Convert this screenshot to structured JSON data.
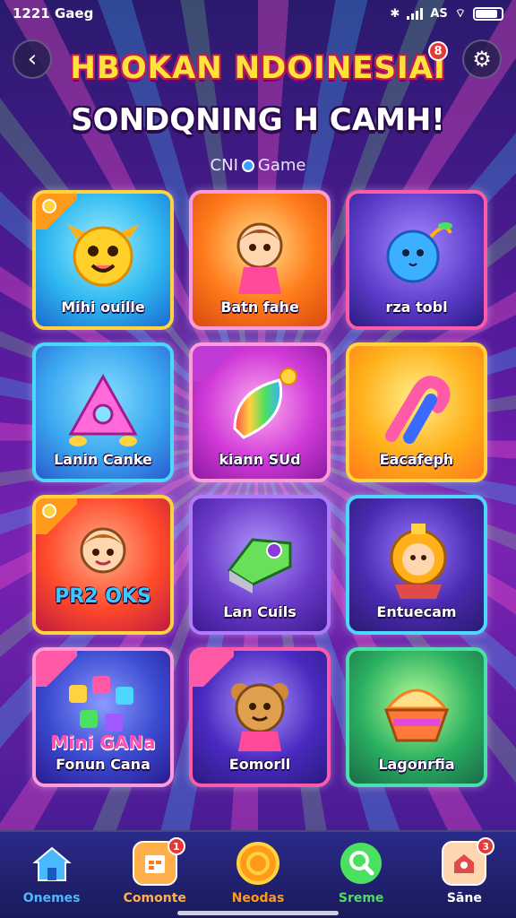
{
  "status_bar": {
    "time": "1221 Gaeg",
    "network": "AS"
  },
  "header": {
    "title_line1": "HBOKAN NDOINESIAI",
    "title_line2": "SONDQNING H CAMH!",
    "subtitle_prefix": "CNI",
    "subtitle_suffix": "Game",
    "title_badge": "8"
  },
  "tiles": [
    {
      "label": "Mihi ouille",
      "icon": "cute-monster-icon",
      "bg": "#2fb8f0"
    },
    {
      "label": "Batn fahe",
      "icon": "girl-character-icon",
      "bg": "#ff7a1a"
    },
    {
      "label": "rza tobl",
      "icon": "blue-ball-icon",
      "bg": "#5a3ac8"
    },
    {
      "label": "Lanin Canke",
      "icon": "donut-candy-icon",
      "bg": "#3aa8f0"
    },
    {
      "label": "kiann SUd",
      "icon": "rainbow-gem-icon",
      "bg": "#d03ad8"
    },
    {
      "label": "Eacafeph",
      "icon": "candy-cane-icon",
      "bg": "#ffb01a"
    },
    {
      "label": "PR2 OKS",
      "icon": "girl-character-icon",
      "bg": "#ff4a2a"
    },
    {
      "label": "Lan Cuils",
      "icon": "green-gem-icon",
      "bg": "#6a3ac8"
    },
    {
      "label": "Entuecam",
      "icon": "monkey-character-icon",
      "bg": "#4a2ab0"
    },
    {
      "label": "Fonun Cana",
      "big_label": "Mini GANa",
      "icon": "candy-blocks-icon",
      "bg": "#3a4ad0"
    },
    {
      "label": "Eomorll",
      "icon": "bear-character-icon",
      "bg": "#4a2ac0"
    },
    {
      "label": "Lagonrfia",
      "icon": "ice-cream-bowl-icon",
      "bg": "#2ab060"
    }
  ],
  "bottom_nav": [
    {
      "label": "Onemes",
      "icon": "home-icon",
      "color": "#4ab8ff",
      "badge": ""
    },
    {
      "label": "Comonte",
      "icon": "calendar-icon",
      "color": "#ffb04a",
      "badge": "1"
    },
    {
      "label": "Neodas",
      "icon": "coin-icon",
      "color": "#ff9a1a",
      "badge": ""
    },
    {
      "label": "Sreme",
      "icon": "search-icon",
      "color": "#4ae060",
      "badge": ""
    },
    {
      "label": "Sāne",
      "icon": "shop-icon",
      "color": "#ffffff",
      "badge": "3"
    }
  ]
}
